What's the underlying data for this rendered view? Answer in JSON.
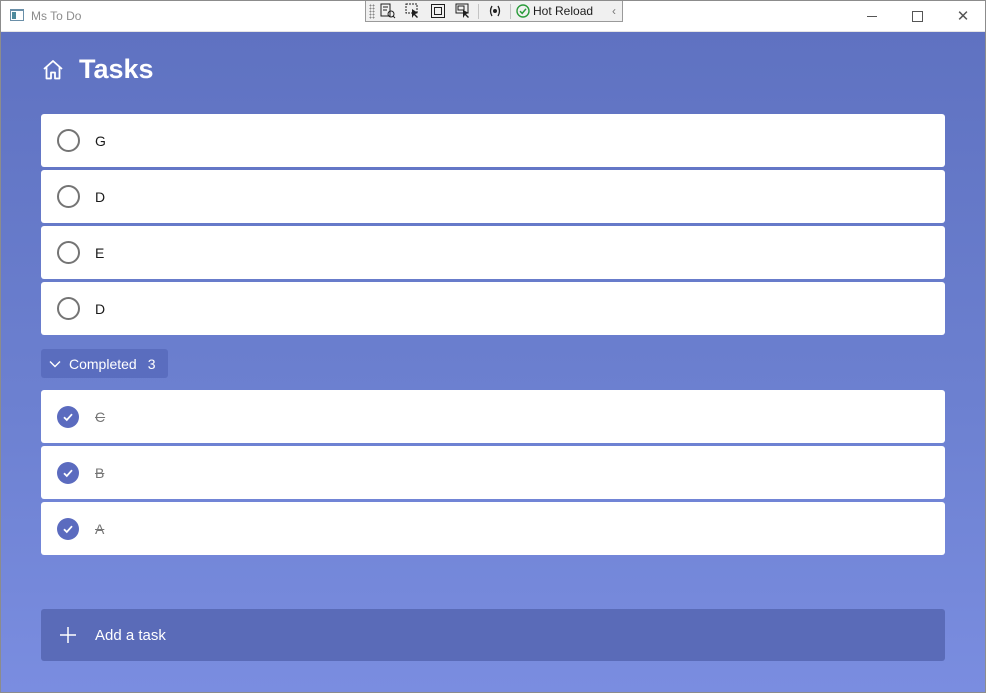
{
  "window": {
    "title": "Ms To Do",
    "close_glyph": "✕"
  },
  "debug_toolbar": {
    "hot_reload_label": "Hot Reload",
    "collapse_glyph": "‹",
    "tools": [
      "show-in-live-visual-tree-icon",
      "select-element-icon",
      "display-layout-adorners-icon",
      "track-focused-element-icon",
      "binding-failures-icon"
    ]
  },
  "header": {
    "title": "Tasks",
    "icon": "home-icon"
  },
  "tasks": [
    {
      "title": "G"
    },
    {
      "title": "D"
    },
    {
      "title": "E"
    },
    {
      "title": "D"
    }
  ],
  "completed_section": {
    "label": "Completed",
    "count": "3",
    "icon": "chevron-down-icon"
  },
  "completed_tasks": [
    {
      "title": "C"
    },
    {
      "title": "B"
    },
    {
      "title": "A"
    }
  ],
  "add_task": {
    "label": "Add a task",
    "icon": "plus-icon"
  },
  "colors": {
    "accent": "#5b6bbf",
    "background_top": "#5f72c1",
    "background_bottom": "#7a8de0",
    "add_task_bg": "#5a6bb8"
  }
}
